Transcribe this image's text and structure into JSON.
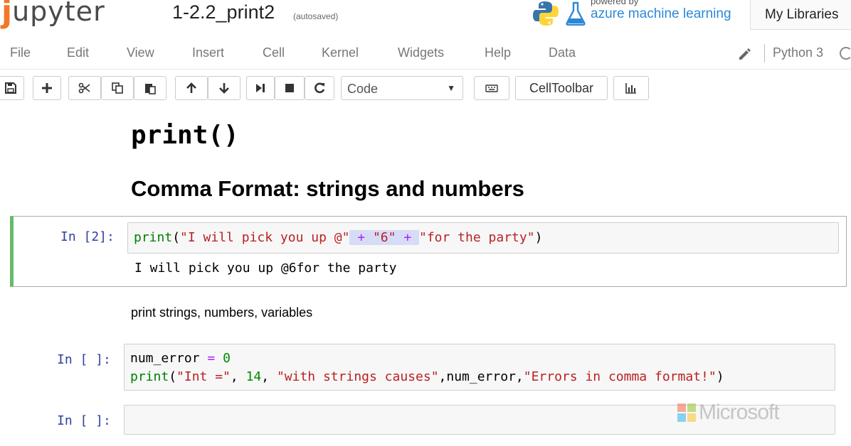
{
  "header": {
    "logo_text": "jupyter",
    "notebook_name": "1-2.2_print2",
    "autosave_status": "(autosaved)",
    "azure_powered": "powered by",
    "azure_brand": "azure machine learning",
    "my_libraries": "My Libraries"
  },
  "menu": {
    "items": [
      "File",
      "Edit",
      "View",
      "Insert",
      "Cell",
      "Kernel",
      "Widgets",
      "Help",
      "Data"
    ],
    "kernel_name": "Python 3"
  },
  "toolbar": {
    "cell_type": "Code",
    "celltoolbar_label": "CellToolbar",
    "icons": [
      "save-icon",
      "plus-icon",
      "cut-icon",
      "copy-icon",
      "paste-icon",
      "arrow-up-icon",
      "arrow-down-icon",
      "run-icon",
      "stop-icon",
      "restart-icon",
      "keyboard-icon",
      "chart-icon"
    ]
  },
  "notebook": {
    "md_title": "print()",
    "md_subtitle": "Comma Format: strings and numbers",
    "md_note": "print strings, numbers, variables",
    "cells": [
      {
        "prompt": "In [2]:",
        "code_tokens": [
          {
            "t": "print",
            "c": "kw"
          },
          {
            "t": "(",
            "c": "plain"
          },
          {
            "t": "\"I will pick you up @\"",
            "c": "str"
          },
          {
            "t": " + ",
            "c": "op"
          },
          {
            "t": "\"6\"",
            "c": "str"
          },
          {
            "t": " + ",
            "c": "op"
          },
          {
            "t": "\"for the party\"",
            "c": "str"
          },
          {
            "t": ")",
            "c": "plain"
          }
        ],
        "output": "I will pick you up @6for the party"
      },
      {
        "prompt": "In [ ]:",
        "line1_tokens": [
          {
            "t": "num_error",
            "c": "plain"
          },
          {
            "t": " = ",
            "c": "op"
          },
          {
            "t": "0",
            "c": "num"
          }
        ],
        "line2_tokens": [
          {
            "t": "print",
            "c": "kw"
          },
          {
            "t": "(",
            "c": "plain"
          },
          {
            "t": "\"Int =\"",
            "c": "str"
          },
          {
            "t": ", ",
            "c": "plain"
          },
          {
            "t": "14",
            "c": "num"
          },
          {
            "t": ", ",
            "c": "plain"
          },
          {
            "t": "\"with strings causes\"",
            "c": "str"
          },
          {
            "t": ",num_error,",
            "c": "plain"
          },
          {
            "t": "\"Errors in comma format!\"",
            "c": "str"
          },
          {
            "t": ")",
            "c": "plain"
          }
        ]
      },
      {
        "prompt": "In [ ]:"
      }
    ]
  },
  "watermark": "Microsoft",
  "colors": {
    "jupyter_orange": "#f37726",
    "selected_cell_border": "#66bb6a",
    "prompt_blue": "#303f9f",
    "azure_blue": "#2b88d8"
  }
}
